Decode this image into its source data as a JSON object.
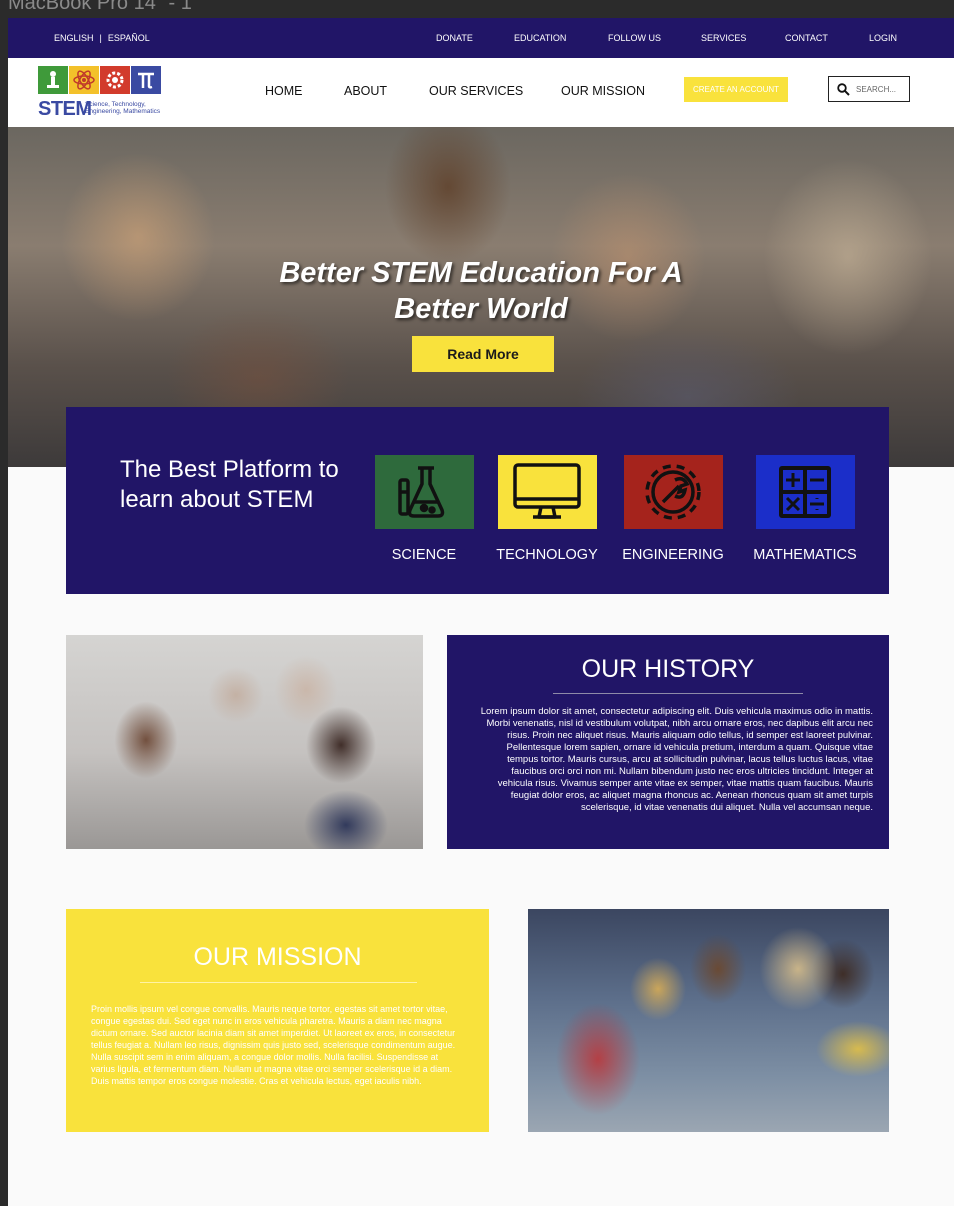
{
  "frame_label": "MacBook Pro 14\" - 1",
  "topbar": {
    "languages": [
      "ENGLISH",
      "ESPAÑOL"
    ],
    "links": [
      "DONATE",
      "EDUCATION",
      "FOLLOW US",
      "SERVICES",
      "CONTACT",
      "LOGIN"
    ]
  },
  "header": {
    "logo_word": "STEM",
    "logo_tagline": "Science, Technology, Engineering, Mathematics",
    "logo_tiles": [
      "science-tile",
      "atom-tile",
      "gear-tile",
      "pi-tile"
    ],
    "nav": [
      "HOME",
      "ABOUT",
      "OUR SERVICES",
      "OUR MISSION"
    ],
    "create_account": "CREATE AN ACCOUNT",
    "search_placeholder": "SEARCH..."
  },
  "hero": {
    "title": "Better STEM Education For A Better World",
    "button": "Read More"
  },
  "platform": {
    "title": "The Best Platform to learn about STEM",
    "subjects": [
      {
        "label": "SCIENCE",
        "color": "#2e6a3c",
        "icon": "flask-icon"
      },
      {
        "label": "TECHNOLOGY",
        "color": "#f9e23c",
        "icon": "monitor-icon"
      },
      {
        "label": "ENGINEERING",
        "color": "#a5231c",
        "icon": "gear-wrench-icon"
      },
      {
        "label": "MATHEMATICS",
        "color": "#1b2ec9",
        "icon": "calculator-icon"
      }
    ]
  },
  "history": {
    "title": "OUR HISTORY",
    "body": "Lorem ipsum dolor sit amet, consectetur adipiscing elit. Duis vehicula maximus odio in mattis. Morbi venenatis, nisl id vestibulum volutpat, nibh arcu ornare eros, nec dapibus elit arcu nec risus. Proin nec aliquet risus. Mauris aliquam odio tellus, id semper est laoreet pulvinar. Pellentesque lorem sapien, ornare id vehicula pretium, interdum a quam. Quisque vitae tempus tortor. Mauris cursus, arcu at sollicitudin pulvinar, lacus tellus luctus lacus, vitae faucibus orci orci non mi. Nullam bibendum justo nec eros ultricies tincidunt. Integer at vehicula risus. Vivamus semper ante vitae ex semper, vitae mattis quam faucibus. Mauris feugiat dolor eros, ac aliquet magna rhoncus ac. Aenean rhoncus quam sit amet turpis scelerisque, id vitae venenatis dui aliquet. Nulla vel accumsan neque."
  },
  "mission": {
    "title": "OUR MISSION",
    "body": "Proin mollis ipsum vel congue convallis. Mauris neque tortor, egestas sit amet tortor vitae, congue egestas dui. Sed eget nunc in eros vehicula pharetra. Mauris a diam nec magna dictum ornare. Sed auctor lacinia diam sit amet imperdiet. Ut laoreet ex eros, in consectetur tellus feugiat a. Nullam leo risus, dignissim quis justo sed, scelerisque condimentum augue. Nulla suscipit sem in enim aliquam, a congue dolor mollis. Nulla facilisi. Suspendisse at varius ligula, et fermentum diam. Nullam ut magna vitae orci semper scelerisque id a diam. Duis mattis tempor eros congue molestie. Cras et vehicula lectus, eget iaculis nibh."
  },
  "colors": {
    "navy": "#211567",
    "yellow": "#f9e23c",
    "logo_blue": "#3a4aa2"
  }
}
